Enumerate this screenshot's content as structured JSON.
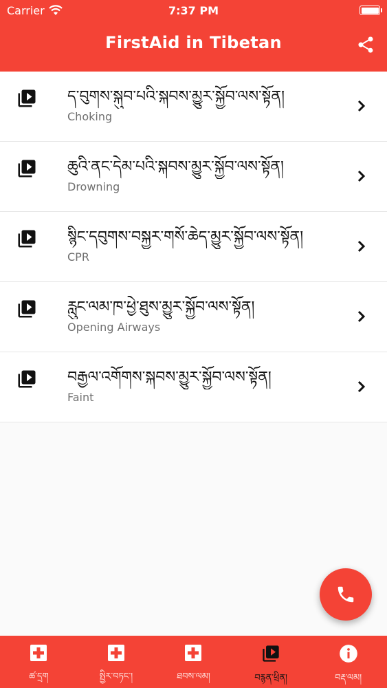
{
  "status_bar": {
    "carrier": "Carrier",
    "time": "7:37 PM"
  },
  "app_bar": {
    "title": "FirstAid in Tibetan",
    "share_icon": "share-icon"
  },
  "videos": [
    {
      "title": "ད་བུགས་སྐུབ་པའི་སྐབས་མྱུར་སྐྱོབ་ལས་སྟོན།",
      "subtitle": "Choking"
    },
    {
      "title": "ཆུའི་ནང་དེམ་པའི་སྐབས་མྱུར་སྐྱོབ་ལས་སྟོན།",
      "subtitle": "Drowning"
    },
    {
      "title": "སྙིང་དབུགས་བསྐྱར་གསོ་ཆེད་མྱུར་སྐྱོབ་ལས་སྟོན།",
      "subtitle": "CPR"
    },
    {
      "title": "རླུང་ལམ་ཁ་ཕྱེ་ཐུས་མྱུར་སྐྱོབ་ལས་སྟོན།",
      "subtitle": "Opening Airways"
    },
    {
      "title": "བརྒྱལ་འགོགས་སྐབས་མྱུར་སྐྱོབ་ལས་སྟོན།",
      "subtitle": "Faint"
    }
  ],
  "bottom_nav": [
    {
      "label": "ཚ་དྲག",
      "icon": "first-aid-icon",
      "active": false
    },
    {
      "label": "སྤྱིར་བཏང་།",
      "icon": "first-aid-icon",
      "active": false
    },
    {
      "label": "ཐབས་ལམ།",
      "icon": "first-aid-icon",
      "active": false
    },
    {
      "label": "བརྙན་ཕྲིན།",
      "icon": "video-library-icon",
      "active": true
    },
    {
      "label": "བརྡ་ལམ།",
      "icon": "info-icon",
      "active": false
    }
  ],
  "colors": {
    "primary": "#f44336",
    "background": "#fafafa"
  }
}
